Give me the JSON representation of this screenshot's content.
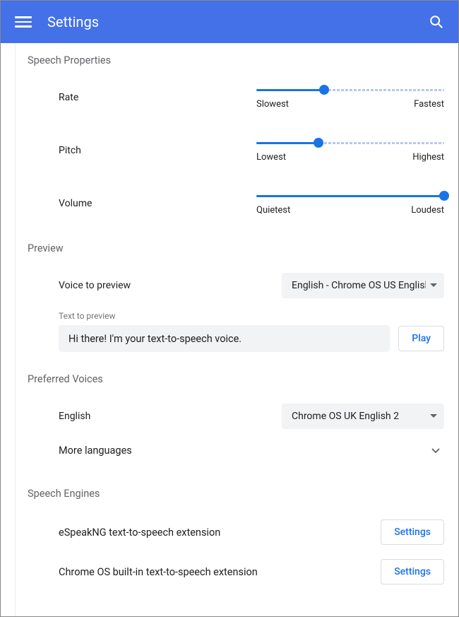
{
  "toolbar": {
    "title": "Settings"
  },
  "speechProperties": {
    "title": "Speech Properties",
    "rate": {
      "label": "Rate",
      "min_label": "Slowest",
      "max_label": "Fastest",
      "value_pct": 36
    },
    "pitch": {
      "label": "Pitch",
      "min_label": "Lowest",
      "max_label": "Highest",
      "value_pct": 33
    },
    "volume": {
      "label": "Volume",
      "min_label": "Quietest",
      "max_label": "Loudest",
      "value_pct": 100
    }
  },
  "preview": {
    "title": "Preview",
    "voice_label": "Voice to preview",
    "voice_selected": "English - Chrome OS US English",
    "text_label": "Text to preview",
    "text_value": "Hi there! I'm your text-to-speech voice.",
    "play_label": "Play"
  },
  "preferredVoices": {
    "title": "Preferred Voices",
    "english_label": "English",
    "english_selected": "Chrome OS UK English 2",
    "more_label": "More languages"
  },
  "speechEngines": {
    "title": "Speech Engines",
    "engines": [
      {
        "name": "eSpeakNG text-to-speech extension",
        "button": "Settings"
      },
      {
        "name": "Chrome OS built-in text-to-speech extension",
        "button": "Settings"
      }
    ]
  }
}
